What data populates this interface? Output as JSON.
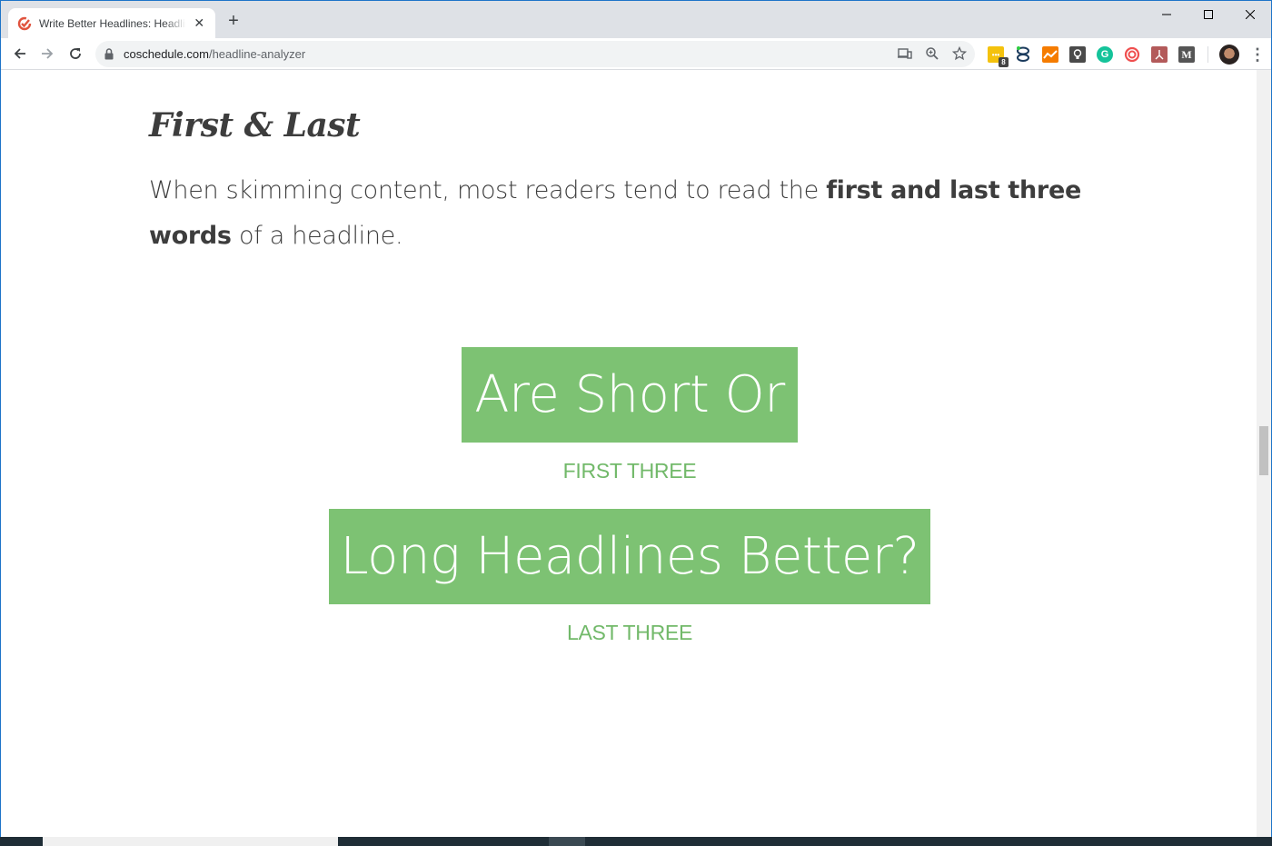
{
  "browser": {
    "tab": {
      "title": "Write Better Headlines: Headline Analyzer",
      "favicon": "coschedule-check-icon",
      "close_glyph": "✕"
    },
    "new_tab_glyph": "+",
    "window_controls": {
      "minimize": "—",
      "maximize": "☐",
      "close": "✕"
    },
    "nav": {
      "back": "←",
      "forward": "→",
      "reload": "⟳"
    },
    "address": {
      "domain": "coschedule.com",
      "path": "/headline-analyzer"
    },
    "omnibox_icons": [
      "cast-icon",
      "zoom-icon",
      "bookmark-star-icon"
    ],
    "extensions": [
      {
        "name": "yellow-ext-icon",
        "color": "#f4c20d",
        "badge": "8"
      },
      {
        "name": "loop-ext-icon",
        "color": "#ffffff"
      },
      {
        "name": "analytics-ext-icon",
        "color": "#f57c00"
      },
      {
        "name": "lightbulb-ext-icon",
        "color": "#4a4a4a"
      },
      {
        "name": "grammarly-icon",
        "color": "#15c39a"
      },
      {
        "name": "spiral-ext-icon",
        "color": "#ef4f4f"
      },
      {
        "name": "pdf-ext-icon",
        "color": "#b35a5a"
      },
      {
        "name": "medium-ext-icon",
        "color": "#555555"
      }
    ]
  },
  "page": {
    "section_title": "First & Last",
    "body": {
      "part1": "When skimming content, most readers tend to read the ",
      "bold1": "first and last three words",
      "part2": " of a headline."
    },
    "examples": [
      {
        "text": "Are Short Or",
        "label": "FIRST THREE"
      },
      {
        "text": "Long Headlines Better?",
        "label": "LAST THREE"
      }
    ]
  },
  "colors": {
    "accent_green": "#7dc273",
    "label_green": "#72b96a",
    "body_text": "#3d3d3d"
  }
}
